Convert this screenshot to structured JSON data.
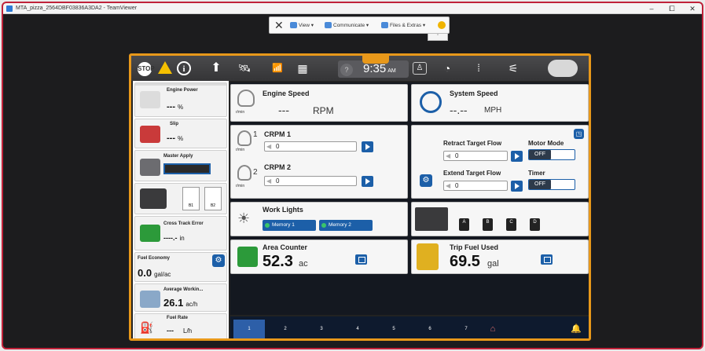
{
  "window": {
    "title": "MTA_pizza_2564DBF03836A3DA2 - TeamViewer",
    "minimize": "–",
    "maximize": "⧠",
    "close": "✕"
  },
  "teamviewer": {
    "close": "✕",
    "view": "View ▾",
    "communicate": "Communicate ▾",
    "files": "Files & Extras ▾"
  },
  "topbar": {
    "time": "9:35",
    "ampm": "AM",
    "stop_icon": "STOP",
    "info_icon": "i",
    "help_icon": "?"
  },
  "sidebar": {
    "engine_power": {
      "label": "Engine Power",
      "value": "---",
      "unit": "%"
    },
    "slip": {
      "label": "Slip",
      "value": "---",
      "unit": "%"
    },
    "master_apply": {
      "label": "Master Apply"
    },
    "sections": {
      "b1": "B1",
      "b2": "B2"
    },
    "cross_track": {
      "label": "Cross Track Error",
      "value": "----.-",
      "unit": "in"
    },
    "fuel_economy": {
      "label": "Fuel Economy",
      "value": "0.0",
      "unit": "gal/ac"
    },
    "avg_working": {
      "label": "Average Workin...",
      "value": "26.1",
      "unit": "ac/h"
    },
    "fuel_rate": {
      "label": "Fuel Rate",
      "value": "---",
      "unit": "L/h"
    }
  },
  "main": {
    "engine_speed": {
      "title": "Engine Speed",
      "value": "---",
      "unit": "RPM",
      "icon_label": "r/min"
    },
    "system_speed": {
      "title": "System Speed",
      "value": "--.--",
      "unit": "MPH"
    },
    "crpm1": {
      "title": "CRPM 1",
      "num": "1",
      "value": "0",
      "icon_label": "r/min"
    },
    "crpm2": {
      "title": "CRPM 2",
      "num": "2",
      "value": "0",
      "icon_label": "r/min"
    },
    "retract": {
      "title": "Retract Target Flow",
      "value": "0"
    },
    "extend": {
      "title": "Extend Target Flow",
      "value": "0"
    },
    "motor_mode": {
      "title": "Motor Mode",
      "value": "OFF"
    },
    "timer": {
      "title": "Timer",
      "value": "OFF"
    },
    "work_lights": {
      "title": "Work Lights",
      "mem1": "Memory 1",
      "mem2": "Memory 2"
    },
    "abcd": [
      "A",
      "B",
      "C",
      "D"
    ],
    "area_counter": {
      "title": "Area Counter",
      "value": "52.3",
      "unit": "ac"
    },
    "trip_fuel": {
      "title": "Trip Fuel Used",
      "value": "69.5",
      "unit": "gal"
    }
  },
  "bottom": {
    "pages": [
      "1",
      "2",
      "3",
      "4",
      "5",
      "6",
      "7"
    ]
  },
  "colors": {
    "accent_orange": "#e8981a",
    "button_blue": "#1c5fa8",
    "frame_red": "#c0223a"
  }
}
